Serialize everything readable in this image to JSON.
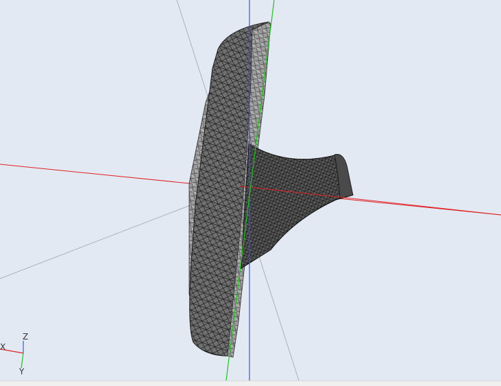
{
  "viewer": {
    "background": "#e3e9f3",
    "axis_colors": {
      "x": "#e02020",
      "y": "#20c020",
      "z": "#4050e0",
      "helper": "#a8b0bc"
    },
    "mesh_fill": "#6f6f6f",
    "mesh_edge": "#1e1e1e",
    "mesh_edge_light": "#e8e8e8"
  },
  "triad": {
    "x_label": "X",
    "y_label": "Y",
    "z_label": "Z"
  }
}
